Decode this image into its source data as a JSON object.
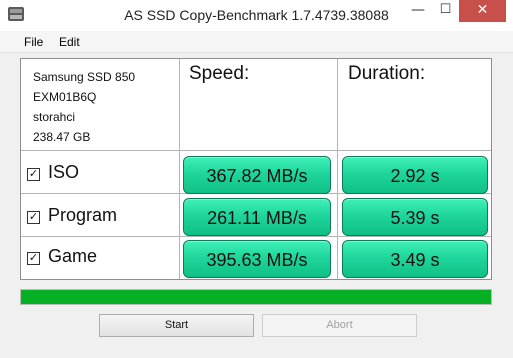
{
  "window": {
    "title": "AS SSD Copy-Benchmark 1.7.4739.38088",
    "controls": {
      "minimize": "—",
      "maximize": "☐",
      "close": "✕"
    }
  },
  "menu": [
    "File",
    "Edit"
  ],
  "drive": {
    "model": "Samsung SSD 850",
    "firmware": "EXM01B6Q",
    "driver": "storahci",
    "capacity": "238.47 GB"
  },
  "headers": {
    "speed": "Speed:",
    "duration": "Duration:"
  },
  "rows": [
    {
      "label": "ISO",
      "checked": true,
      "speed": "367.82 MB/s",
      "duration": "2.92 s"
    },
    {
      "label": "Program",
      "checked": true,
      "speed": "261.11 MB/s",
      "duration": "5.39 s"
    },
    {
      "label": "Game",
      "checked": true,
      "speed": "395.63 MB/s",
      "duration": "3.49 s"
    }
  ],
  "progress": {
    "value": 1.0,
    "color": "#06b025"
  },
  "buttons": {
    "start": "Start",
    "abort": "Abort"
  },
  "colors": {
    "result_green": "#1fd69c",
    "close_red": "#c7514a"
  }
}
